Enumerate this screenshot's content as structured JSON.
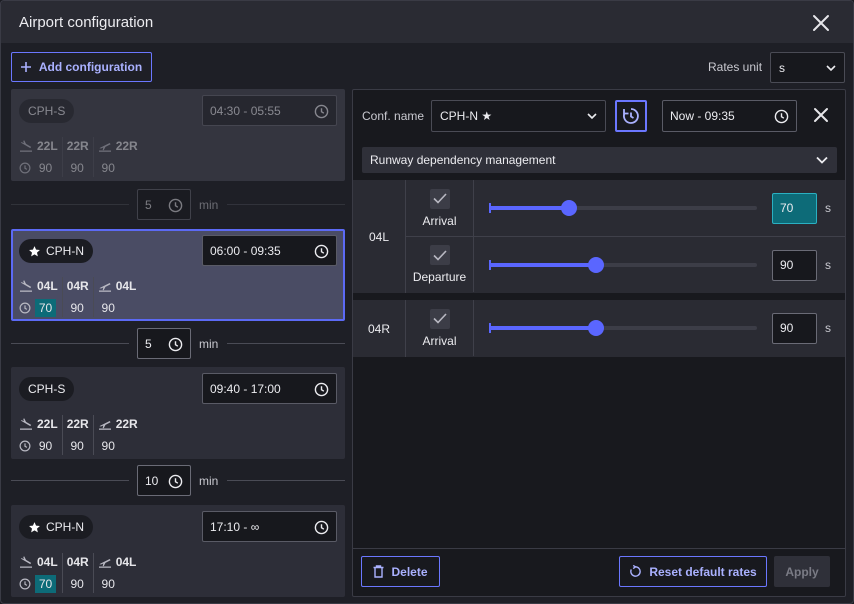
{
  "dialog": {
    "title": "Airport configuration"
  },
  "toolbar": {
    "add_label": "Add configuration",
    "rates_unit_label": "Rates unit",
    "rates_unit_value": "s"
  },
  "configs": [
    {
      "name": "CPH-S",
      "starred": false,
      "time": "04:30 - 05:55",
      "runways": [
        {
          "icon": "arrival",
          "id": "22L",
          "rate": "90"
        },
        {
          "icon": "none",
          "id": "22R",
          "rate": "90"
        },
        {
          "icon": "departure",
          "id": "22R",
          "rate": "90"
        }
      ]
    },
    {
      "name": "CPH-N",
      "starred": true,
      "time": "06:00 - 09:35",
      "runways": [
        {
          "icon": "arrival",
          "id": "04L",
          "rate": "70"
        },
        {
          "icon": "none",
          "id": "04R",
          "rate": "90"
        },
        {
          "icon": "departure",
          "id": "04L",
          "rate": "90"
        }
      ]
    },
    {
      "name": "CPH-S",
      "starred": false,
      "time": "09:40 - 17:00",
      "runways": [
        {
          "icon": "arrival",
          "id": "22L",
          "rate": "90"
        },
        {
          "icon": "none",
          "id": "22R",
          "rate": "90"
        },
        {
          "icon": "departure",
          "id": "22R",
          "rate": "90"
        }
      ]
    },
    {
      "name": "CPH-N",
      "starred": true,
      "time": "17:10 - ∞",
      "runways": [
        {
          "icon": "arrival",
          "id": "04L",
          "rate": "70"
        },
        {
          "icon": "none",
          "id": "04R",
          "rate": "90"
        },
        {
          "icon": "departure",
          "id": "04L",
          "rate": "90"
        }
      ]
    }
  ],
  "gaps": [
    {
      "value": "5",
      "unit": "min"
    },
    {
      "value": "5",
      "unit": "min"
    },
    {
      "value": "10",
      "unit": "min"
    }
  ],
  "editor": {
    "conf_label": "Conf. name",
    "conf_name_value": "CPH-N ★",
    "time_value": "Now - 09:35",
    "section_label": "Runway dependency management",
    "groups": [
      {
        "runway": "04L",
        "ops": [
          {
            "label": "Arrival",
            "value": "70",
            "unit": "s",
            "level": 0.3
          },
          {
            "label": "Departure",
            "value": "90",
            "unit": "s",
            "level": 0.4
          }
        ]
      },
      {
        "runway": "04R",
        "ops": [
          {
            "label": "Arrival",
            "value": "90",
            "unit": "s",
            "level": 0.4
          }
        ]
      }
    ],
    "delete_label": "Delete",
    "reset_label": "Reset default rates",
    "apply_label": "Apply"
  },
  "colors": {
    "accent": "#5a66ff",
    "highlight": "#0d6b78",
    "active_card": "#4a4c64"
  }
}
